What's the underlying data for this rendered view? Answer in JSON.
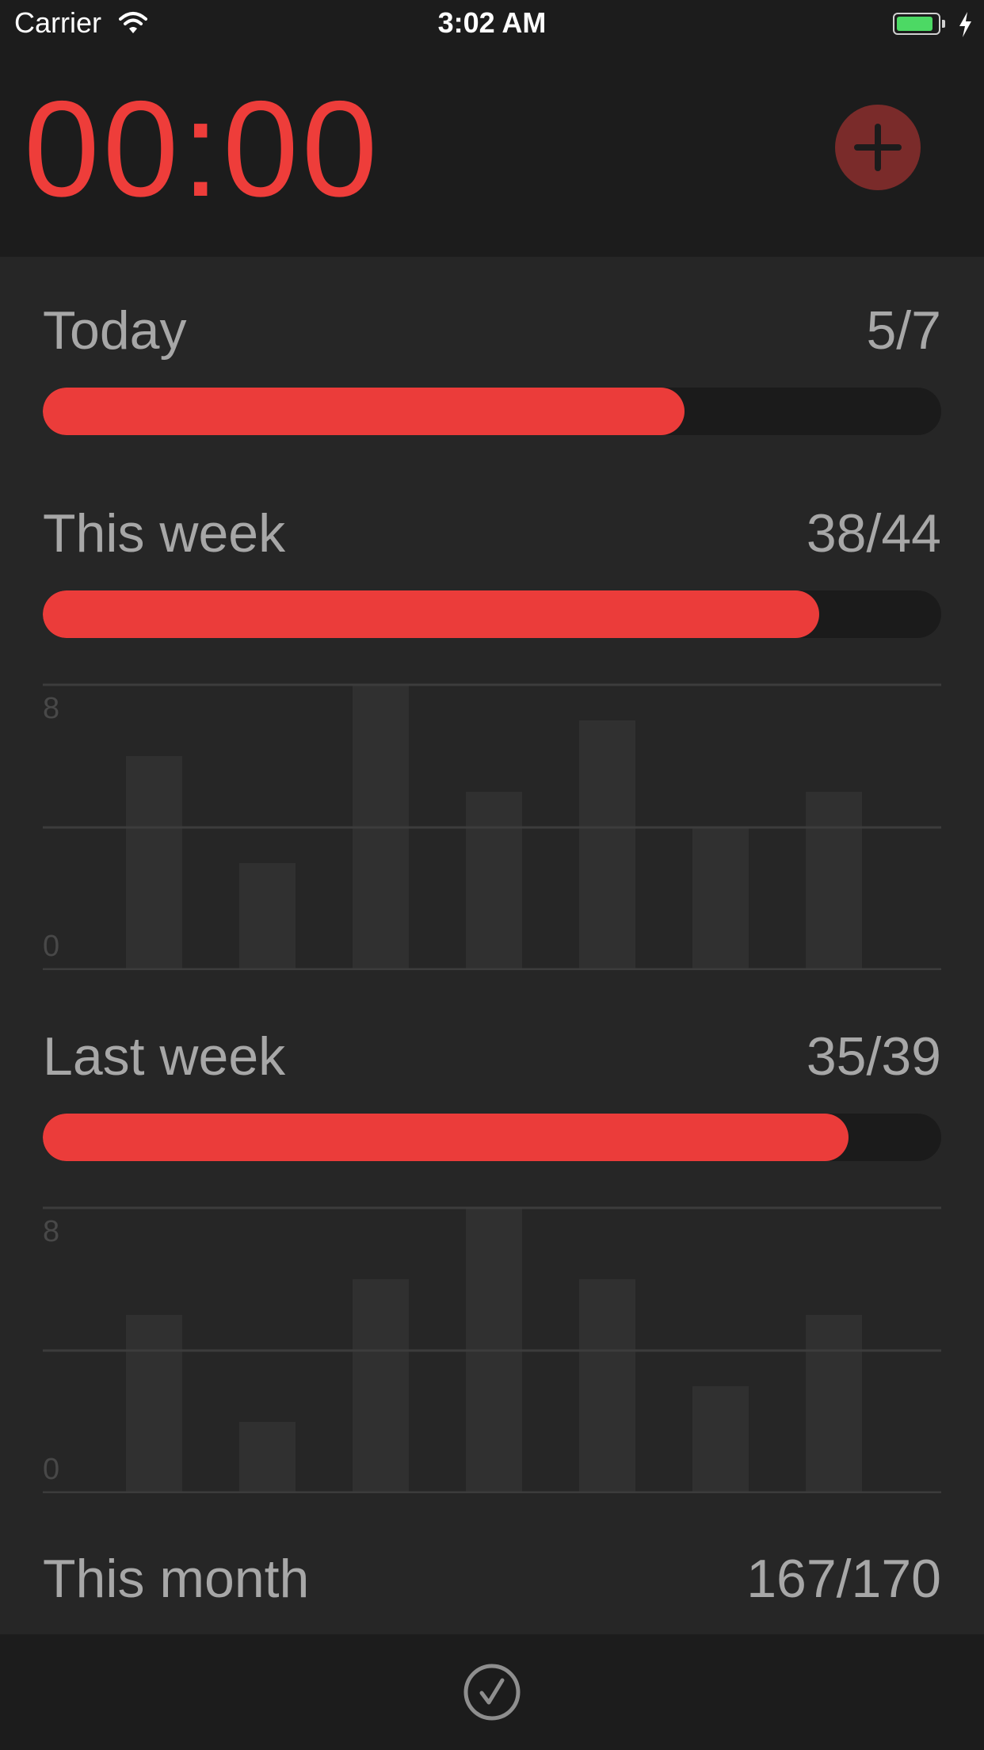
{
  "status_bar": {
    "carrier": "Carrier",
    "time": "3:02 AM",
    "battery_level": 0.9,
    "battery_color": "#4cd964",
    "wifi_icon": "wifi-icon",
    "charging_icon": "bolt-icon"
  },
  "header": {
    "timer": "00:00",
    "timer_color": "#ee3d3a",
    "add_icon": "plus-icon"
  },
  "colors": {
    "accent": "#eb3c3a",
    "track": "#1b1b1b",
    "bar": "#303030",
    "grid": "#3c3c3c",
    "label": "#a7a7a7"
  },
  "sections": {
    "today": {
      "label": "Today",
      "value": "5/7",
      "progress": 0.714
    },
    "this_week": {
      "label": "This week",
      "value": "38/44",
      "progress": 0.864
    },
    "last_week": {
      "label": "Last week",
      "value": "35/39",
      "progress": 0.897
    },
    "this_month": {
      "label": "This month",
      "value": "167/170"
    }
  },
  "chart_data": [
    {
      "type": "bar",
      "ylim": [
        0,
        8
      ],
      "y_ticks": [
        "8",
        "0"
      ],
      "grid": true,
      "values": [
        6,
        3,
        8,
        5,
        7,
        4,
        5
      ]
    },
    {
      "type": "bar",
      "ylim": [
        0,
        8
      ],
      "y_ticks": [
        "8",
        "0"
      ],
      "grid": true,
      "values": [
        5,
        2,
        6,
        8,
        6,
        3,
        5
      ]
    }
  ],
  "footer": {
    "check_icon": "checkmark-circle-icon"
  }
}
